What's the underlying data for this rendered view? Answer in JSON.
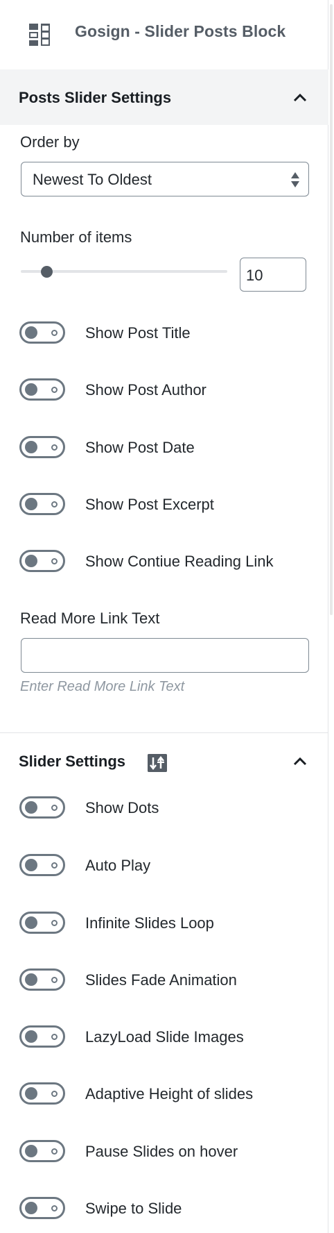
{
  "block": {
    "title": "Gosign - Slider Posts Block",
    "icon": "block-grid-icon"
  },
  "posts_section": {
    "title": "Posts Slider Settings",
    "expanded": true,
    "order_by": {
      "label": "Order by",
      "value": "Newest To Oldest"
    },
    "number_of_items": {
      "label": "Number of items",
      "value": "10",
      "slider_fraction": 0.1
    },
    "toggles": [
      {
        "label": "Show Post Title",
        "on": false
      },
      {
        "label": "Show Post Author",
        "on": false
      },
      {
        "label": "Show Post Date",
        "on": false
      },
      {
        "label": "Show Post Excerpt",
        "on": false
      },
      {
        "label": "Show Contiue Reading Link",
        "on": false
      }
    ],
    "read_more": {
      "label": "Read More Link Text",
      "value": "",
      "help": "Enter Read More Link Text"
    }
  },
  "slider_section": {
    "title": "Slider Settings",
    "badge_icon": "sort-icon",
    "expanded": true,
    "toggles": [
      {
        "label": "Show Dots",
        "on": false
      },
      {
        "label": "Auto Play",
        "on": false
      },
      {
        "label": "Infinite Slides Loop",
        "on": false
      },
      {
        "label": "Slides Fade Animation",
        "on": false
      },
      {
        "label": "LazyLoad Slide Images",
        "on": false
      },
      {
        "label": "Adaptive Height of slides",
        "on": false
      },
      {
        "label": "Pause Slides on hover",
        "on": false
      },
      {
        "label": "Swipe to Slide",
        "on": false
      }
    ]
  },
  "colors": {
    "text": "#23282d",
    "toggle_off": "#6c7781",
    "section_bg": "#f3f4f5",
    "help_text": "#8f98a1"
  }
}
